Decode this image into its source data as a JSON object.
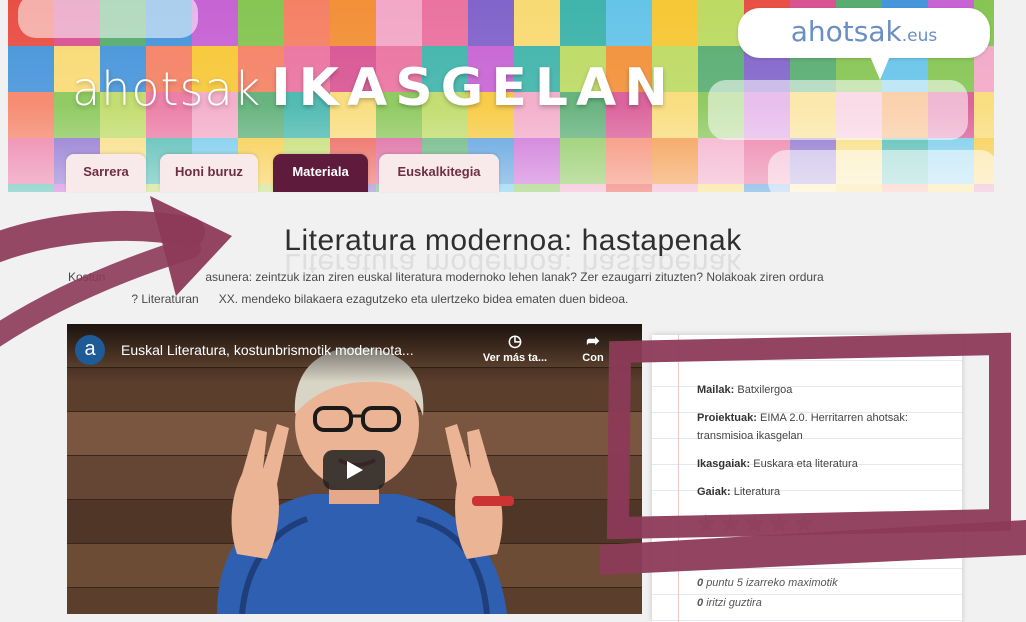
{
  "colors": {
    "accent": "#5e1b3b",
    "marker": "#8c3a57",
    "tab_bg": "#f8e9ea",
    "logo_text": "#6a8fc4",
    "mosaic": [
      "#e8463b",
      "#f28a2e",
      "#f6c42b",
      "#7fc24a",
      "#35b0a6",
      "#3d8fd8",
      "#7b5cc7",
      "#d64a8c",
      "#f1a3c3",
      "#b9d85a",
      "#f47a5c",
      "#5ec1e8",
      "#c45bd1",
      "#f8d86c",
      "#4fa86a",
      "#e96b9a"
    ]
  },
  "header": {
    "logo_main": "ahotsak",
    "logo_suffix": ".eus",
    "title_light": "ahotsak",
    "title_bold": "IKASGELAN"
  },
  "tabs": [
    {
      "label": "Sarrera",
      "active": false
    },
    {
      "label": "Honi buruz",
      "active": false
    },
    {
      "label": "Materiala",
      "active": true
    },
    {
      "label": "Euskalkitegia",
      "active": false
    }
  ],
  "page": {
    "title": "Literatura modernoa: hastapenak",
    "intro_line1": "Kostun                              asunera: zeintzuk izan ziren euskal literatura modernoko lehen lanak? Zer ezaugarri zituzten? Nolakoak ziren ordura",
    "intro_line2": "                   ? Literaturan      XX. mendeko bilakaera ezagutzeko eta ulertzeko bidea ematen duen bideoa."
  },
  "video": {
    "channel_logo": "a",
    "title": "Euskal Literatura, kostunbrismotik modernota...",
    "watch_later_label": "Ver más ta...",
    "share_label": "Con",
    "watch_later_icon": "clock-icon",
    "share_icon": "share-icon",
    "play_icon": "play-icon"
  },
  "side": {
    "level_label": "Mailak:",
    "level_value": "Batxilergoa",
    "project_label": "Proiektuak:",
    "project_value": "EIMA 2.0. Herritarren ahotsak: transmisioa ikasgelan",
    "subjects_label": "Ikasgaiak:",
    "subjects_value": "Euskara eta literatura",
    "topics_label": "Gaiak:",
    "topics_value": "Literatura",
    "stars": "★★★★★",
    "rating_value": 0,
    "rating_text_num": "0",
    "rating_text": "puntu 5 izarreko maximotik",
    "opinions_num": "0",
    "opinions_text": "iritzi guztira"
  }
}
